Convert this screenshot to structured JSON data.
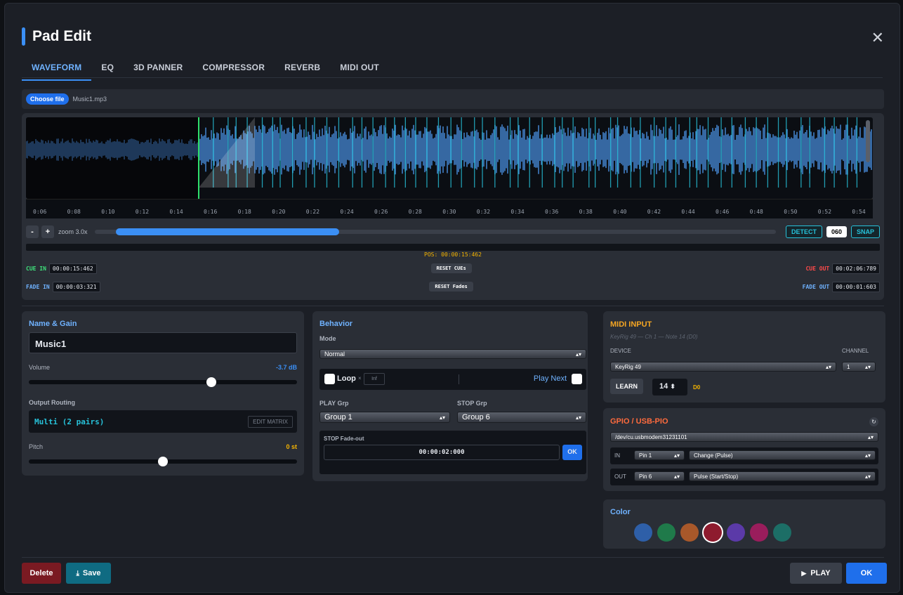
{
  "dialog": {
    "title": "Pad Edit",
    "close_glyph": "✕"
  },
  "tabs": [
    {
      "label": "WAVEFORM",
      "active": true
    },
    {
      "label": "EQ",
      "active": false
    },
    {
      "label": "3D PANNER",
      "active": false
    },
    {
      "label": "COMPRESSOR",
      "active": false
    },
    {
      "label": "REVERB",
      "active": false
    },
    {
      "label": "MIDI OUT",
      "active": false
    }
  ],
  "file": {
    "button_label": "Choose file",
    "filename": "Music1.mp3"
  },
  "waveform": {
    "ticks": [
      "0:06",
      "0:08",
      "0:10",
      "0:12",
      "0:14",
      "0:16",
      "0:18",
      "0:20",
      "0:22",
      "0:24",
      "0:26",
      "0:28",
      "0:30",
      "0:32",
      "0:34",
      "0:36",
      "0:38",
      "0:40",
      "0:42",
      "0:44",
      "0:46",
      "0:48",
      "0:50",
      "0:52",
      "0:54"
    ],
    "zoom_minus": "-",
    "zoom_plus": "+",
    "zoom_label": "zoom 3.0x",
    "detect_label": "DETECT",
    "bpm_value": "060",
    "snap_label": "SNAP",
    "position": "POS: 00:00:15:462",
    "cue_in_label": "CUE IN",
    "cue_in_value": "00:00:15:462",
    "reset_cues_label": "RESET CUEs",
    "cue_out_label": "CUE OUT",
    "cue_out_value": "00:02:06:789",
    "fade_in_label": "FADE IN",
    "fade_in_value": "00:00:03:321",
    "reset_fades_label": "RESET Fades",
    "fade_out_label": "FADE OUT",
    "fade_out_value": "00:00:01:603"
  },
  "name_gain": {
    "title": "Name & Gain",
    "name_value": "Music1",
    "volume_label": "Volume",
    "volume_value": "-3.7 dB",
    "volume_position": 0.68,
    "routing_label": "Output Routing",
    "routing_value": "Multi (2 pairs)",
    "edit_matrix_label": "EDIT MATRIX",
    "pitch_label": "Pitch",
    "pitch_value": "0 st",
    "pitch_position": 0.5
  },
  "behavior": {
    "title": "Behavior",
    "mode_label": "Mode",
    "mode_value": "Normal",
    "loop_label": "Loop",
    "loop_x": "×",
    "loop_count_placeholder": "Inf",
    "play_next_label": "Play Next",
    "play_grp_label": "PLAY Grp",
    "play_grp_value": "Group 1",
    "stop_grp_label": "STOP Grp",
    "stop_grp_value": "Group 6",
    "stop_fadeout_label": "STOP Fade-out",
    "stop_fadeout_value": "00:00:02:000",
    "ok_label": "OK"
  },
  "midi_input": {
    "title": "MIDI INPUT",
    "subtitle": "KeyRig 49 — Ch 1 — Note 14 (D0)",
    "device_label": "DEVICE",
    "device_value": "KeyRig 49",
    "channel_label": "CHANNEL",
    "channel_value": "1",
    "learn_label": "LEARN",
    "note_value": "14",
    "note_name": "D0"
  },
  "gpio": {
    "title": "GPIO / USB-PIO",
    "refresh_glyph": "↻",
    "port_value": "/dev/cu.usbmodem31231101",
    "in_label": "IN",
    "in_pin": "Pin 1",
    "in_mode": "Change (Pulse)",
    "out_label": "OUT",
    "out_pin": "Pin 6",
    "out_mode": "Pulse (Start/Stop)"
  },
  "color": {
    "title": "Color",
    "swatches": [
      "#2e5fa8",
      "#1f7a4a",
      "#a8582a",
      "#8e1b2e",
      "#5b3aa8",
      "#9a1d5c",
      "#1c6e66"
    ],
    "selected_index": 3
  },
  "footer": {
    "delete_label": "Delete",
    "save_label": "Save",
    "save_glyph": "⤓",
    "play_label": "PLAY",
    "play_glyph": "▶",
    "ok_label": "OK"
  }
}
